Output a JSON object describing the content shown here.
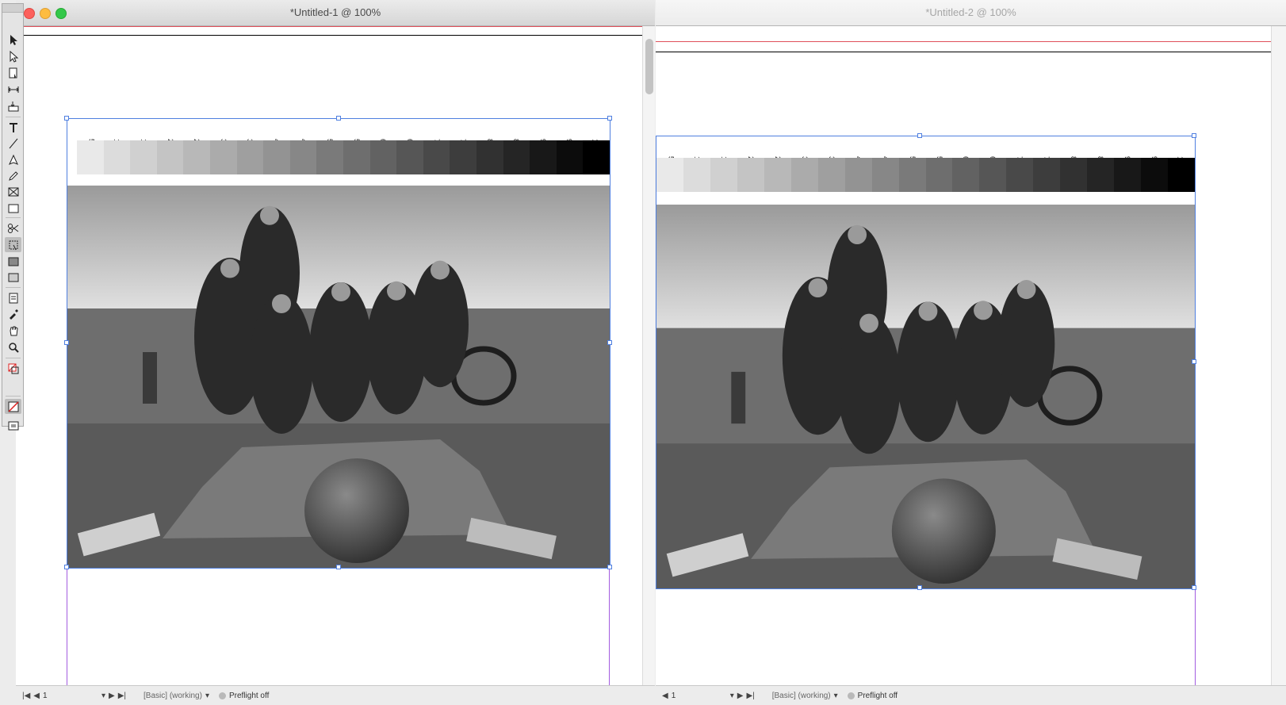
{
  "window1": {
    "title": "*Untitled-1 @ 100%"
  },
  "window2": {
    "title": "*Untitled-2 @ 100%"
  },
  "ramp_labels": [
    "5 k",
    "10 k",
    "15 k",
    "20 k",
    "25 k",
    "30 k",
    "35 k",
    "40 k",
    "45 k",
    "50 k",
    "55 k",
    "60 k",
    "65 k",
    "70 k",
    "75 k",
    "80 k",
    "85 k",
    "90 k",
    "95 k",
    "100 k"
  ],
  "ramp_values": [
    5,
    10,
    15,
    20,
    25,
    30,
    35,
    40,
    45,
    50,
    55,
    60,
    65,
    70,
    75,
    80,
    85,
    90,
    95,
    100
  ],
  "statusbar": {
    "page": "1",
    "profile": "[Basic] (working)",
    "preflight": "Preflight off"
  },
  "colors": {
    "selection": "#4f7fe0",
    "margin_guide": "#e0505a",
    "column_guide": "#a35ce0"
  },
  "tools": [
    "selection-tool",
    "direct-selection-tool",
    "page-tool",
    "gap-tool",
    "content-collector-tool",
    "type-tool",
    "line-tool",
    "pen-tool",
    "pencil-tool",
    "rectangle-frame-tool",
    "rectangle-tool",
    "scissors-tool",
    "free-transform-tool",
    "gradient-swatch-tool",
    "gradient-feather-tool",
    "note-tool",
    "eyedropper-tool",
    "hand-tool",
    "zoom-tool",
    "fill-stroke-swatch",
    "apply-none",
    "screen-mode"
  ]
}
